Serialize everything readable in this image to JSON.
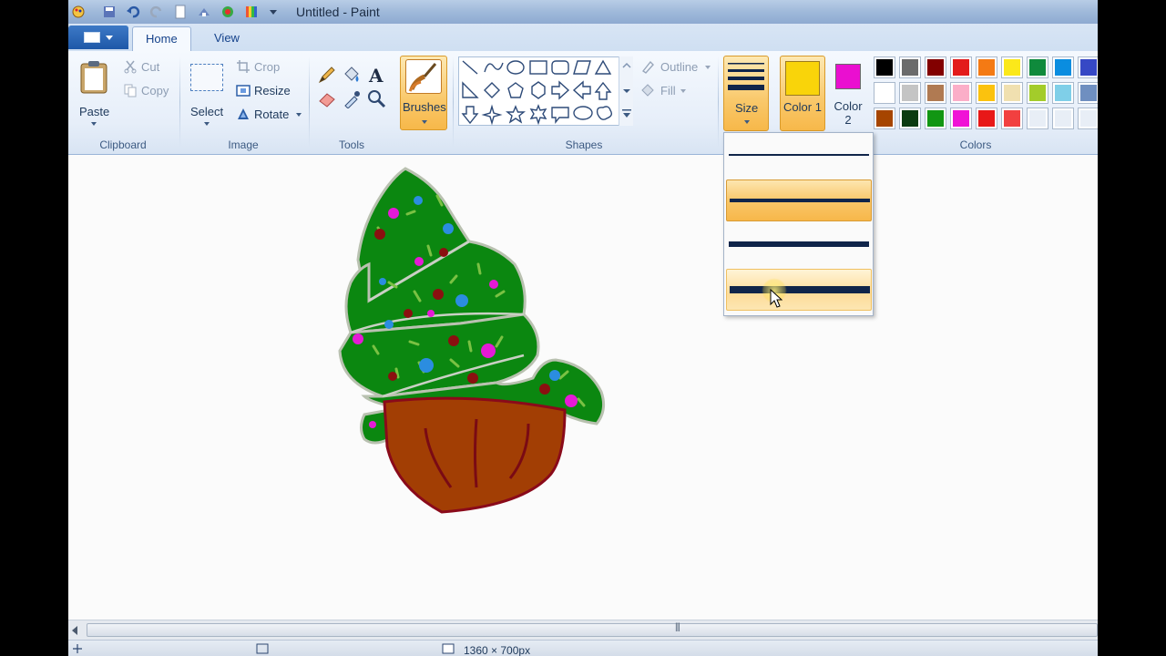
{
  "window": {
    "title": "Untitled - Paint"
  },
  "tabs": [
    {
      "label": "Home"
    },
    {
      "label": "View"
    }
  ],
  "clipboard": {
    "group_label": "Clipboard",
    "paste": "Paste",
    "cut": "Cut",
    "copy": "Copy"
  },
  "image": {
    "group_label": "Image",
    "select": "Select",
    "crop": "Crop",
    "resize": "Resize",
    "rotate": "Rotate"
  },
  "tools": {
    "group_label": "Tools"
  },
  "brushes": {
    "label": "Brushes"
  },
  "shapes": {
    "group_label": "Shapes",
    "outline": "Outline",
    "fill": "Fill"
  },
  "size": {
    "label": "Size",
    "options_count_shown": 4,
    "selected_index": 1,
    "hovered_index": 3
  },
  "colors": {
    "group_label": "Colors",
    "color1_label": "Color 1",
    "color2_label": "Color 2",
    "color1": "#f9d40a",
    "color2": "#ea0fd0",
    "palette": [
      "#000000",
      "#6b6b6b",
      "#820000",
      "#e31b1b",
      "#f47a14",
      "#fbe81a",
      "#0f8a3c",
      "#0a8de0",
      "#3648c5",
      "#ffffff",
      "#c4c4c4",
      "#b07a52",
      "#fbaec8",
      "#fbc20e",
      "#f0e0b0",
      "#a3cc2a",
      "#7fcfe8",
      "#6f8fc0",
      "#a64500",
      "#0b3b10",
      "#119613",
      "#f012d6",
      "#e81818",
      "#f24040",
      "#e8eef6",
      "#e8eef6",
      "#e8eef6"
    ]
  },
  "status": {
    "dimensions": "1360 × 700px"
  }
}
